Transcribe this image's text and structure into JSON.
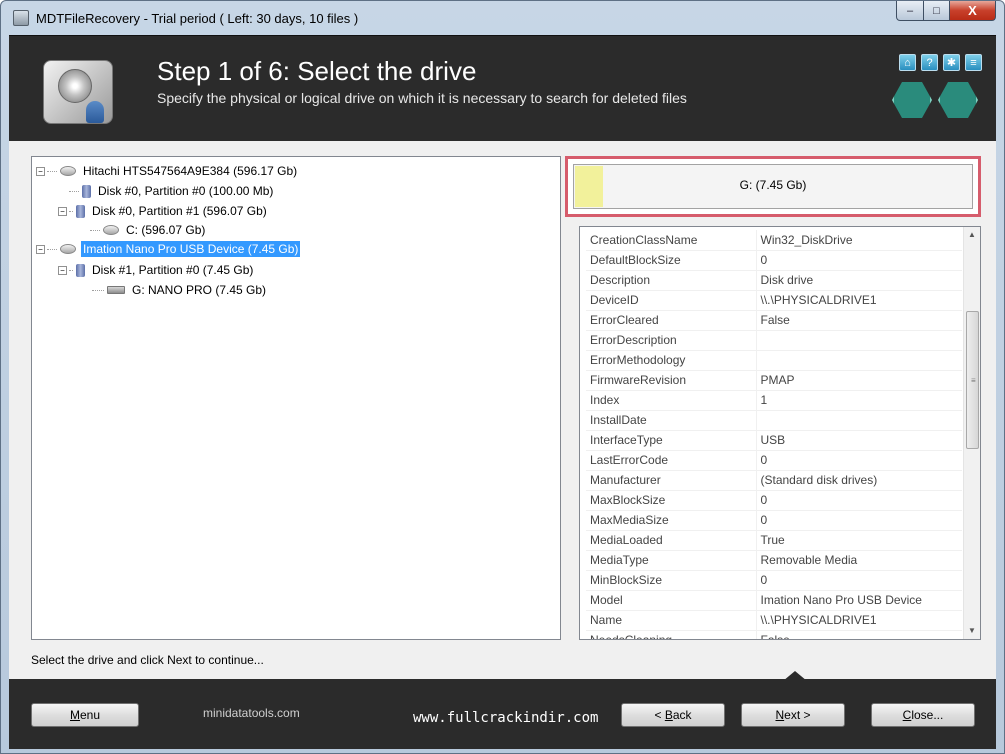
{
  "window": {
    "title": "MDTFileRecovery - Trial period ( Left: 30 days, 10 files )",
    "controls": {
      "minimize": "–",
      "maximize": "□",
      "close": "X"
    }
  },
  "header": {
    "step_title": "Step 1 of 6: Select the drive",
    "step_description": "Specify the physical or logical drive on which it is necessary to search for deleted files",
    "icons": [
      "home-icon",
      "help-icon",
      "settings-icon",
      "info-icon"
    ]
  },
  "tree": {
    "nodes": [
      {
        "label": "Hitachi HTS547564A9E384 (596.17 Gb)",
        "type": "disk",
        "expander": "−"
      },
      {
        "label": "Disk #0, Partition #0 (100.00 Mb)",
        "type": "partition"
      },
      {
        "label": "Disk #0, Partition #1 (596.07 Gb)",
        "type": "partition",
        "expander": "−"
      },
      {
        "label": "C:  (596.07 Gb)",
        "type": "volume"
      },
      {
        "label": "Imation Nano Pro USB Device (7.45 Gb)",
        "type": "disk",
        "expander": "−",
        "selected": true
      },
      {
        "label": "Disk #1, Partition #0 (7.45 Gb)",
        "type": "partition",
        "expander": "−"
      },
      {
        "label": "G: NANO PRO (7.45 Gb)",
        "type": "usb-volume"
      }
    ]
  },
  "drive_preview": {
    "label": "G: (7.45 Gb)",
    "used_fraction": 0.07
  },
  "properties": {
    "rows": [
      {
        "key": "CreationClassName",
        "value": "Win32_DiskDrive"
      },
      {
        "key": "DefaultBlockSize",
        "value": "0"
      },
      {
        "key": "Description",
        "value": "Disk drive"
      },
      {
        "key": "DeviceID",
        "value": "\\\\.\\PHYSICALDRIVE1"
      },
      {
        "key": "ErrorCleared",
        "value": "False"
      },
      {
        "key": "ErrorDescription",
        "value": ""
      },
      {
        "key": "ErrorMethodology",
        "value": ""
      },
      {
        "key": "FirmwareRevision",
        "value": "PMAP"
      },
      {
        "key": "Index",
        "value": "1"
      },
      {
        "key": "InstallDate",
        "value": ""
      },
      {
        "key": "InterfaceType",
        "value": "USB"
      },
      {
        "key": "LastErrorCode",
        "value": "0"
      },
      {
        "key": "Manufacturer",
        "value": "(Standard disk drives)"
      },
      {
        "key": "MaxBlockSize",
        "value": "0"
      },
      {
        "key": "MaxMediaSize",
        "value": "0"
      },
      {
        "key": "MediaLoaded",
        "value": "True"
      },
      {
        "key": "MediaType",
        "value": "Removable Media"
      },
      {
        "key": "MinBlockSize",
        "value": "0"
      },
      {
        "key": "Model",
        "value": "Imation Nano Pro USB Device"
      },
      {
        "key": "Name",
        "value": "\\\\.\\PHYSICALDRIVE1"
      },
      {
        "key": "NeedsCleaning",
        "value": "False"
      }
    ],
    "scrollbar": {
      "up": "▲",
      "down": "▼",
      "grip": "≡"
    }
  },
  "status_text": "Select the drive and click Next to continue...",
  "footer": {
    "menu_hotkey": "M",
    "menu_rest": "enu",
    "site": "minidatatools.com",
    "watermark": "www.fullcrackindir.com",
    "back_prefix": "< ",
    "back_hotkey": "B",
    "back_rest": "ack",
    "next_hotkey": "N",
    "next_rest": "ext >",
    "close_hotkey": "C",
    "close_rest": "lose..."
  },
  "colors": {
    "header_bg": "#2b2b2b",
    "selection": "#3399ff",
    "highlight_border": "#d65c6c",
    "drive_fill": "#f2f19b"
  }
}
